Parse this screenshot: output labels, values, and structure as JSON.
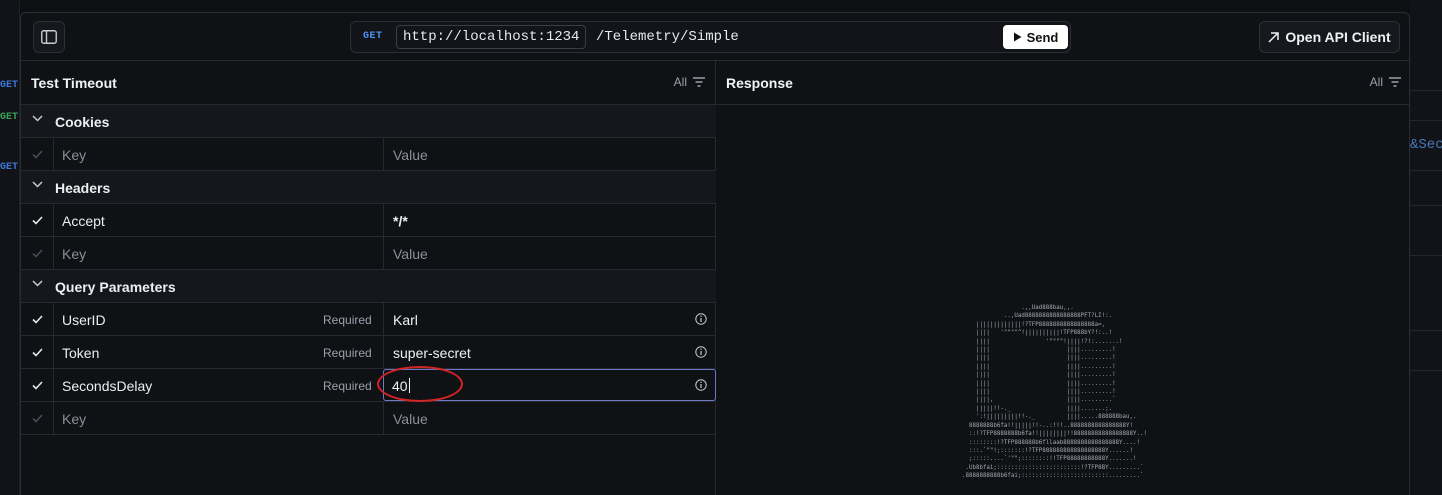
{
  "background": {
    "left_methods": [
      "GET",
      "GET",
      "GET"
    ],
    "right_url_fragment": "&Sec"
  },
  "topbar": {
    "method": "GET",
    "server": "http://localhost:1234",
    "path": "/Telemetry/Simple",
    "send_label": "Send",
    "open_client_label": "Open API Client"
  },
  "request": {
    "title": "Test Timeout",
    "filter_label": "All",
    "sections": {
      "cookies": "Cookies",
      "headers": "Headers",
      "query": "Query Parameters"
    },
    "placeholders": {
      "key": "Key",
      "value": "Value"
    },
    "required_label": "Required",
    "headers": [
      {
        "key": "Accept",
        "value": "*/*",
        "enabled": true
      }
    ],
    "query_params": [
      {
        "key": "UserID",
        "value": "Karl",
        "required": true,
        "enabled": true
      },
      {
        "key": "Token",
        "value": "super-secret",
        "required": true,
        "enabled": true
      },
      {
        "key": "SecondsDelay",
        "value": "40",
        "required": true,
        "enabled": true,
        "focused": true
      }
    ]
  },
  "response": {
    "title": "Response",
    "filter_label": "All",
    "ascii_art": [
      "                 .,,Uad888bau,,.",
      "            ..,Uad8888888888888888PFT?LI!:.",
      "    |||||||||||||!?TFP8888888888888888a=,",
      "    ||||   '\"\"\"\"^!||||||||||!TFP888bY?!:..!",
      "    ||||                '\"\"\"\"!||||!?!:.......!",
      "    ||||                      ||||.........!",
      "    ||||                      ||||.........!",
      "    ||||                      ||||.........!",
      "    ||||                      ||||.........!",
      "    ||||                      ||||.........!",
      "    ||||                      ||||.........!",
      "    ||||,                     ||||.........`",
      "    |||||!!-._                ||||.......;.",
      "    ':!|||||||||!!-._         ||||.....888888bau,.",
      "  8888888b6fa!!|||||!!-..:!!!..8888888888888888Y!",
      "  ::!?TFP8888888b6fa!!||||||||!!88888888888888888Y..!",
      "  ::::::::!?TFP888888b6fllaab8888888888888888Y....!",
      "  :::.`\"\"!;:::::::!?TFP888888888888888888Y......!",
      "  ;:::::....`'\"\";::::::::!!TFP88888888888Y.......!",
      " .Ub8bfai;::::::::::::::::::::::::!?TFP8BY.........`",
      ".8888888888b6fai;:::::::::::::::::::::::::.........`"
    ]
  },
  "colors": {
    "accent": "#4f8ff0",
    "focus_border": "#6c79c8",
    "annotation": "#d42424",
    "send_bg": "#ffffff"
  },
  "icons": [
    "sidebar-toggle-icon",
    "play-icon",
    "external-arrow-icon",
    "filter-icon",
    "chevron-down-icon",
    "check-icon",
    "info-icon"
  ]
}
